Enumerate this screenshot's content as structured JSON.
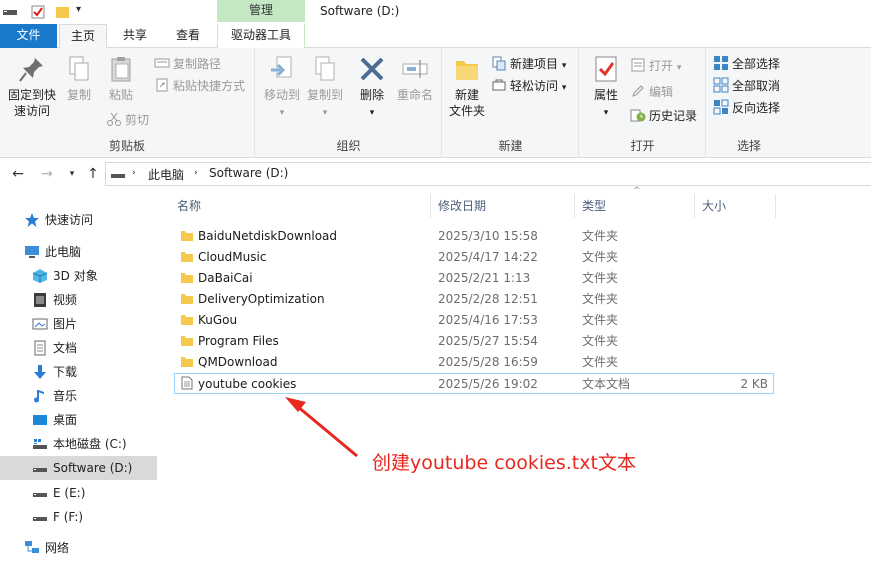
{
  "window": {
    "title": "Software (D:)",
    "context_tab_group": "管理"
  },
  "ribbon_tabs": {
    "file": "文件",
    "home": "主页",
    "share": "共享",
    "view": "查看",
    "drive_tools": "驱动器工具"
  },
  "ribbon": {
    "clipboard": {
      "label": "剪贴板",
      "pin_quick_access_1": "固定到快",
      "pin_quick_access_2": "速访问",
      "copy": "复制",
      "paste": "粘贴",
      "copy_path": "复制路径",
      "paste_shortcut": "粘贴快捷方式",
      "cut": "剪切"
    },
    "organize": {
      "label": "组织",
      "move_to": "移动到",
      "copy_to": "复制到",
      "delete": "删除",
      "rename": "重命名"
    },
    "new": {
      "label": "新建",
      "new_folder_1": "新建",
      "new_folder_2": "文件夹",
      "new_item": "新建项目",
      "easy_access": "轻松访问"
    },
    "open": {
      "label": "打开",
      "properties": "属性",
      "open": "打开",
      "edit": "编辑",
      "history": "历史记录"
    },
    "select": {
      "label": "选择",
      "select_all": "全部选择",
      "select_none": "全部取消",
      "invert_selection": "反向选择"
    }
  },
  "address": {
    "segments": [
      "此电脑",
      "Software (D:)"
    ]
  },
  "nav_pane": {
    "items": [
      {
        "label": "快速访问",
        "icon": "star-icon"
      },
      {
        "label": "此电脑",
        "icon": "computer-icon"
      },
      {
        "label": "3D 对象",
        "icon": "3d-objects-icon"
      },
      {
        "label": "视频",
        "icon": "video-icon"
      },
      {
        "label": "图片",
        "icon": "pictures-icon"
      },
      {
        "label": "文档",
        "icon": "documents-icon"
      },
      {
        "label": "下载",
        "icon": "download-icon"
      },
      {
        "label": "音乐",
        "icon": "music-icon"
      },
      {
        "label": "桌面",
        "icon": "desktop-icon"
      },
      {
        "label": "本地磁盘 (C:)",
        "icon": "drive-icon"
      },
      {
        "label": "Software (D:)",
        "icon": "drive-icon"
      },
      {
        "label": "E (E:)",
        "icon": "drive-icon"
      },
      {
        "label": "F (F:)",
        "icon": "drive-icon"
      },
      {
        "label": "网络",
        "icon": "network-icon"
      }
    ],
    "selected": "Software (D:)"
  },
  "file_list": {
    "columns": {
      "name": "名称",
      "date": "修改日期",
      "type": "类型",
      "size": "大小"
    },
    "rows": [
      {
        "name": "BaiduNetdiskDownload",
        "date": "2025/3/10 15:58",
        "type": "文件夹",
        "size": "",
        "icon": "folder-icon"
      },
      {
        "name": "CloudMusic",
        "date": "2025/4/17 14:22",
        "type": "文件夹",
        "size": "",
        "icon": "folder-icon"
      },
      {
        "name": "DaBaiCai",
        "date": "2025/2/21 1:13",
        "type": "文件夹",
        "size": "",
        "icon": "folder-icon"
      },
      {
        "name": "DeliveryOptimization",
        "date": "2025/2/28 12:51",
        "type": "文件夹",
        "size": "",
        "icon": "folder-icon"
      },
      {
        "name": "KuGou",
        "date": "2025/4/16 17:53",
        "type": "文件夹",
        "size": "",
        "icon": "folder-icon"
      },
      {
        "name": "Program Files",
        "date": "2025/5/27 15:54",
        "type": "文件夹",
        "size": "",
        "icon": "folder-icon"
      },
      {
        "name": "QMDownload",
        "date": "2025/5/28 16:59",
        "type": "文件夹",
        "size": "",
        "icon": "folder-icon"
      },
      {
        "name": "youtube cookies",
        "date": "2025/5/26 19:02",
        "type": "文本文档",
        "size": "2 KB",
        "icon": "text-file-icon"
      }
    ]
  },
  "annotation": {
    "text": "创建youtube cookies.txt文本",
    "color": "#e8271f"
  },
  "colors": {
    "file_tab": "#1979ca",
    "context_tab": "#c4e8c4",
    "folder": "#f4c94e",
    "selection": "#cce8ff"
  }
}
